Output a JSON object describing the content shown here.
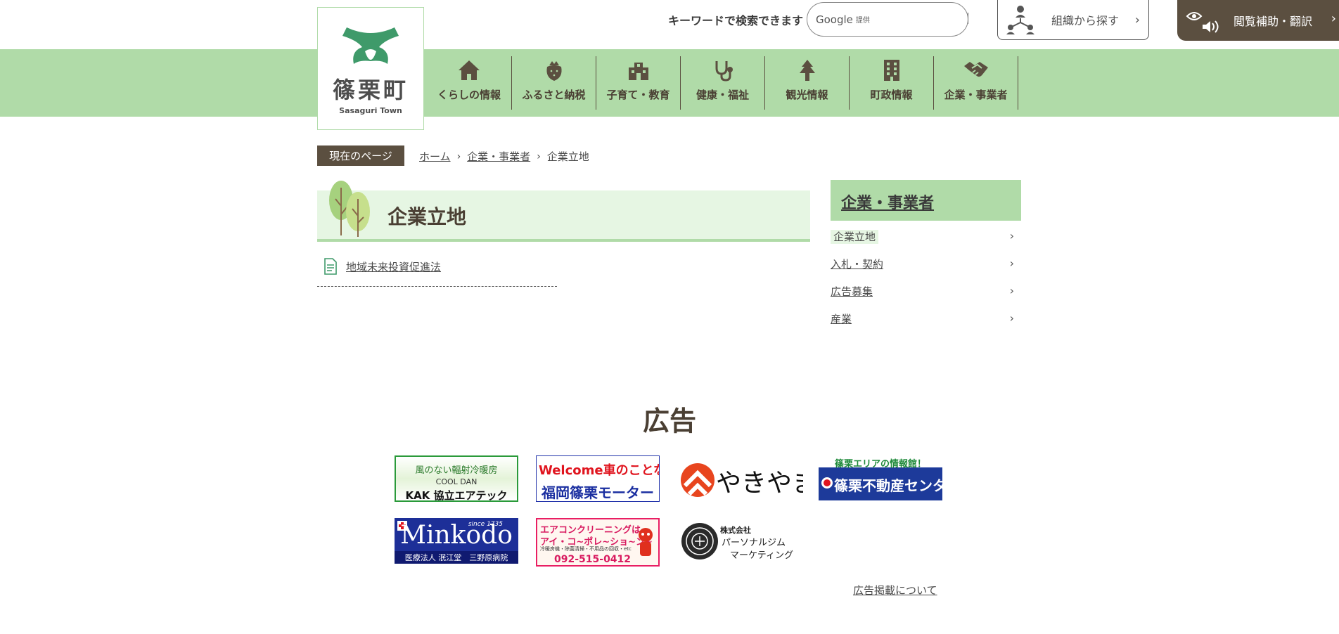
{
  "header": {
    "logo_name": "篠栗町",
    "logo_sub": "Sasaguri Town",
    "search_label": "キーワードで検索できます",
    "search_provider": "Google",
    "search_provider_sub": "提供",
    "search_placeholder": "",
    "org_button": "組織から探す",
    "access_button": "閲覧補助・翻訳"
  },
  "gnav": [
    {
      "label": "くらしの情報",
      "icon": "house-icon"
    },
    {
      "label": "ふるさと納税",
      "icon": "strawberry-icon"
    },
    {
      "label": "子育て・教育",
      "icon": "school-icon"
    },
    {
      "label": "健康・福祉",
      "icon": "stethoscope-icon"
    },
    {
      "label": "観光情報",
      "icon": "tree-icon"
    },
    {
      "label": "町政情報",
      "icon": "building-icon"
    },
    {
      "label": "企業・事業者",
      "icon": "handshake-icon"
    }
  ],
  "breadcrumb": {
    "tag": "現在のページ",
    "items": [
      "ホーム",
      "企業・事業者",
      "企業立地"
    ]
  },
  "main": {
    "title": "企業立地",
    "links": [
      "地域未来投資促進法"
    ]
  },
  "side": {
    "heading": "企業・事業者",
    "items": [
      "企業立地",
      "入札・契約",
      "広告募集",
      "産業"
    ]
  },
  "ads": {
    "title": "広告",
    "items": [
      {
        "lines": [
          "風のない輻射冷暖房",
          "COOL DAN",
          "KAK 協立エアテック"
        ]
      },
      {
        "lines": [
          "Welcome車のことならOK!",
          "福岡篠栗モーター"
        ]
      },
      {
        "lines": [
          "やきやま"
        ]
      },
      {
        "lines": [
          "篠栗エリアの情報館！",
          "篠栗不動産センター"
        ]
      },
      {
        "lines": [
          "Minkodo",
          "医療法人 泯江堂　三野原病院",
          "since 1735"
        ]
      },
      {
        "lines": [
          "エアコンクリーニングは",
          "アイ・コ~ポレ~ショ~ン~",
          "冷暖房機・除菌清掃・不用品の回収・etc",
          "092-515-0412"
        ]
      },
      {
        "lines": [
          "株式会社",
          "パーソナルジム",
          "マーケティング"
        ]
      }
    ],
    "footer_link": "広告掲載について"
  },
  "colors": {
    "band_green": "#b0dba8",
    "light_green": "#e6f6e3",
    "brown": "#5b4f40"
  }
}
